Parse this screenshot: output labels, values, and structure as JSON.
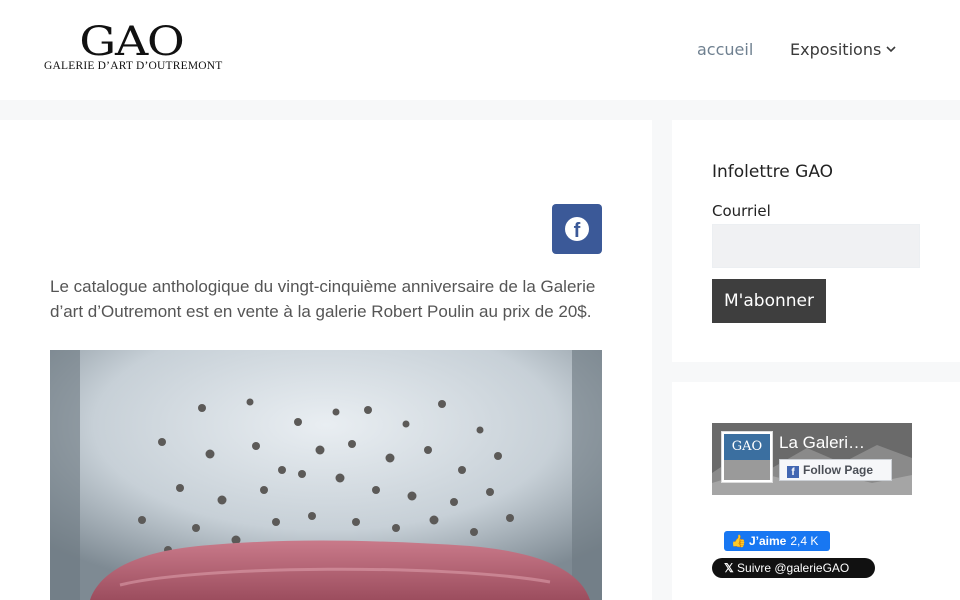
{
  "header": {
    "logo": {
      "wordmark": "GAO",
      "subtitle": "GALERIE D’ART D’OUTREMONT"
    },
    "nav": {
      "home": "accueil",
      "expositions": "Expositions",
      "expositions_caret_icon": "chevron-down-icon"
    }
  },
  "main": {
    "share_icon": "facebook-icon",
    "intro": "Le catalogue anthologique du vingt-cinquième anniversaire de la Galerie d’art d’Outremont est en vente à la galerie Robert Poulin au prix de 20$."
  },
  "newsletter": {
    "title": "Infolettre GAO",
    "email_label": "Courriel",
    "email_value": "",
    "subscribe_label": "M'abonner"
  },
  "social": {
    "fb_page_name": "La Galeri…",
    "fb_thumb_text": "GAO",
    "fb_follow_label": "Follow Page",
    "like_label": "J’aime",
    "like_count": "2,4 K",
    "twitter_follow": "Suivre @galerieGAO"
  },
  "colors": {
    "facebook": "#3b5998",
    "nav_active": "#6f8090",
    "button_dark": "#3e3e3e"
  }
}
